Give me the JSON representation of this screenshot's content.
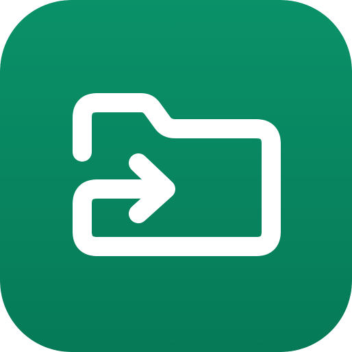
{
  "icon": {
    "name": "folder-move-icon",
    "colors": {
      "background_top": "#0A9168",
      "background_bottom": "#067A57",
      "glyph": "#FFFFFF"
    }
  }
}
